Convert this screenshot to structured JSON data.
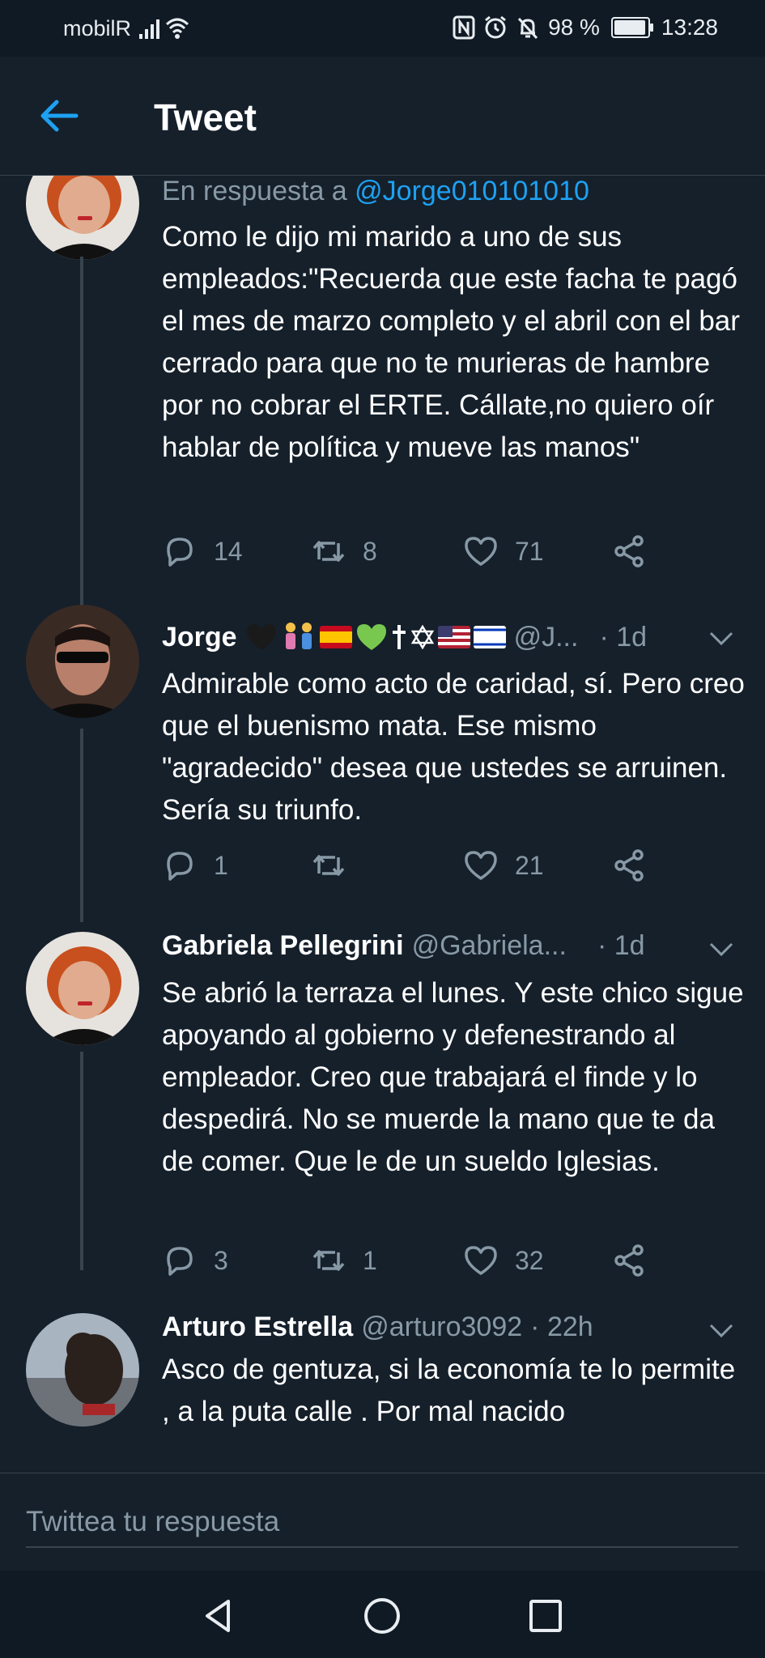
{
  "status_bar": {
    "carrier": "mobilR",
    "battery": "98 %",
    "time": "13:28",
    "icons": [
      "signal-icon",
      "wifi-icon",
      "nfc-icon",
      "alarm-icon",
      "mute-icon",
      "battery-icon"
    ]
  },
  "header": {
    "title": "Tweet",
    "back_icon": "arrow-left-icon"
  },
  "colors": {
    "background": "#15202b",
    "accent": "#1da1f2",
    "muted": "#8899a6",
    "divider": "#38444d"
  },
  "tweets": [
    {
      "reply_prefix": "En respuesta a",
      "reply_mention": "@Jorge010101010",
      "text": "Como le dijo mi marido a uno de sus empleados:\"Recuerda que este facha te pagó el mes de marzo completo y el abril con el bar cerrado para que no te murieras de hambre por no cobrar el ERTE. Cállate,no quiero oír hablar de política y mueve las manos\"",
      "replies": "14",
      "retweets": "8",
      "likes": "71"
    },
    {
      "name": "Jorge",
      "handle": "@J...",
      "time": "· 1d",
      "text": "Admirable como acto de caridad, sí. Pero creo que el buenismo mata. Ese mismo \"agradecido\" desea que ustedes se arruinen. Sería su triunfo.",
      "replies": "1",
      "retweets": "",
      "likes": "21"
    },
    {
      "name": "Gabriela Pellegrini",
      "handle": "@Gabriela...",
      "time": "· 1d",
      "text": "Se abrió la terraza el lunes. Y este chico sigue apoyando al gobierno y defenestrando al empleador. Creo que trabajará el finde y lo despedirá. No se muerde la mano que te da de comer. Que le de un sueldo Iglesias.",
      "replies": "3",
      "retweets": "1",
      "likes": "32"
    },
    {
      "name": "Arturo Estrella",
      "handle": "@arturo3092",
      "time": "· 22h",
      "text": "Asco de gentuza, si la economía te lo permite , a la puta calle . Por mal nacido"
    }
  ],
  "reply_bar": {
    "placeholder": "Twittea tu respuesta"
  },
  "nav": [
    "back-nav-icon",
    "home-nav-icon",
    "recents-nav-icon"
  ]
}
